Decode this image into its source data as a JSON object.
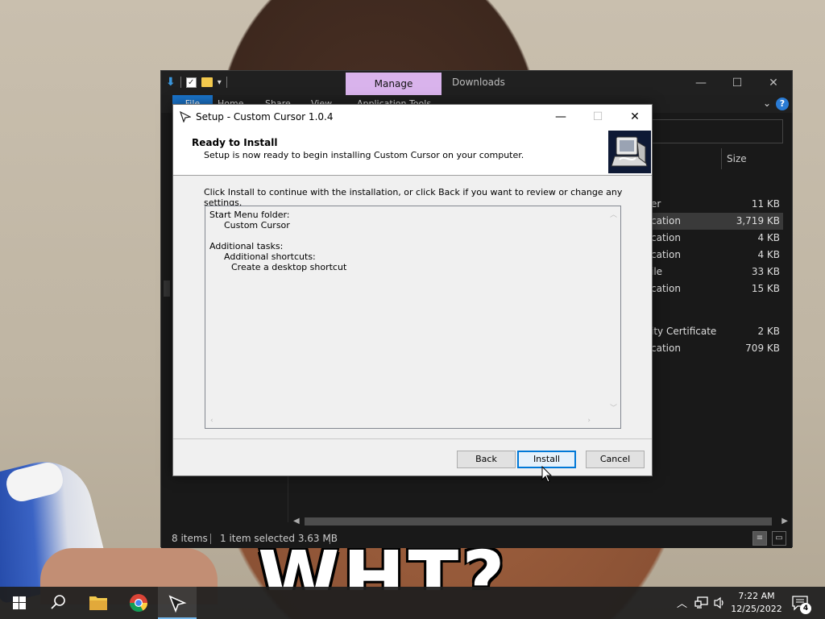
{
  "background": {
    "meme_text": "WHT?"
  },
  "explorer": {
    "title": "Downloads",
    "manage_tab": "Manage",
    "ribbon_tabs": [
      "File",
      "Home",
      "Share",
      "View",
      "Application Tools"
    ],
    "column_header_size": "Size",
    "files": [
      {
        "type": "er",
        "size": "11 KB",
        "selected": false
      },
      {
        "type": "cation",
        "size": "3,719 KB",
        "selected": true
      },
      {
        "type": "cation",
        "size": "4 KB",
        "selected": false
      },
      {
        "type": "cation",
        "size": "4 KB",
        "selected": false
      },
      {
        "type": "ile",
        "size": "33 KB",
        "selected": false
      },
      {
        "type": "cation",
        "size": "15 KB",
        "selected": false
      },
      {
        "type": "ity Certificate",
        "size": "2 KB",
        "selected": false
      },
      {
        "type": "cation",
        "size": "709 KB",
        "selected": false
      }
    ],
    "status": {
      "items": "8 items",
      "selected": "1 item selected  3.63 MB"
    }
  },
  "setup": {
    "title": "Setup - Custom Cursor 1.0.4",
    "header_title": "Ready to Install",
    "header_subtitle": "Setup is now ready to begin installing Custom Cursor on your computer.",
    "instruction": "Click Install to continue with the installation, or click Back if you want to review or change any settings.",
    "memo": {
      "start_menu_heading": "Start Menu folder:",
      "start_menu_value": "Custom Cursor",
      "tasks_heading": "Additional tasks:",
      "tasks_group": "Additional shortcuts:",
      "tasks_item": "Create a desktop shortcut"
    },
    "buttons": {
      "back": "Back",
      "install": "Install",
      "cancel": "Cancel"
    }
  },
  "taskbar": {
    "clock_time": "7:22 AM",
    "clock_date": "12/25/2022",
    "notification_count": "4"
  }
}
